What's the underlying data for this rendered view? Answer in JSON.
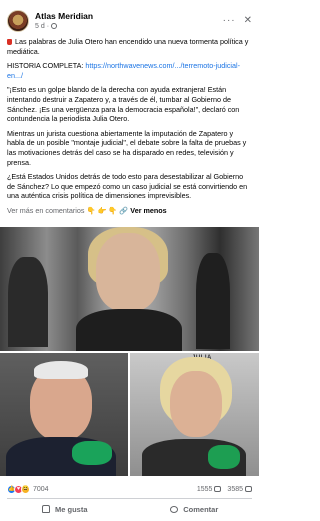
{
  "post": {
    "author": "Atlas Meridian",
    "time": "5 d",
    "more_icon": "ellipsis-icon",
    "close_icon": "close-icon",
    "intro": "Las palabras de Julia Otero han encendido una nueva tormenta política y mediática.",
    "history_label": "HISTORIA COMPLETA:",
    "history_link": "https://northwavenews.com/.../terremoto-judicial-en.../",
    "paragraph1": "\"¡Esto es un golpe blando de la derecha con ayuda extranjera! Están intentando destruir a Zapatero y, a través de él, tumbar al Gobierno de Sánchez. ¡Es una vergüenza para la democracia española!\", declaró con contundencia la periodista Julia Otero.",
    "paragraph2": "Mientras un jurista cuestiona abiertamente la imputación de Zapatero y habla de un posible \"montaje judicial\", el debate sobre la falta de pruebas y las motivaciones detrás del caso se ha disparado en redes, televisión y prensa.",
    "paragraph3": "¿Está Estados Unidos detrás de todo esto para desestabilizar al Gobierno de Sánchez? Lo que empezó como un caso judicial se está convirtiendo en una auténtica crisis política de dimensiones imprevisibles.",
    "see_more_prefix": "Ver más en comentarios 👇 👉 👇 🔗",
    "see_more_label": "Ver menos"
  },
  "media": {
    "top_tag": "",
    "right_tag": "JULIA"
  },
  "stats": {
    "reaction_count": "7004",
    "comments": "1555",
    "shares": "3585"
  },
  "actions": {
    "like_label": "Me gusta",
    "comment_label": "Comentar"
  }
}
